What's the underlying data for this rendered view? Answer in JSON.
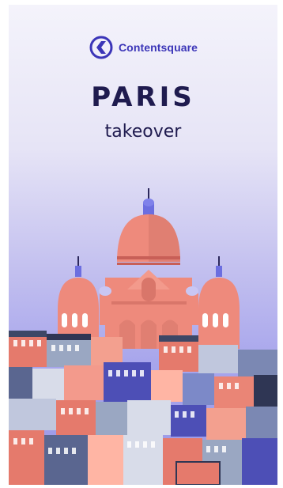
{
  "brand": {
    "name": "Contentsquare",
    "logo_icon": "contentsquare-logo-icon",
    "color": "#3b35b8"
  },
  "title": "PARIS",
  "subtitle": "takeover",
  "illustration": {
    "subject": "sacre-coeur-basilica",
    "colors": {
      "dome": "#ee8a7c",
      "dome_shade": "#d9766a",
      "lantern": "#6c6ee0",
      "sky_top": "#f4f3fb",
      "sky_bottom": "#9a97e6"
    }
  }
}
